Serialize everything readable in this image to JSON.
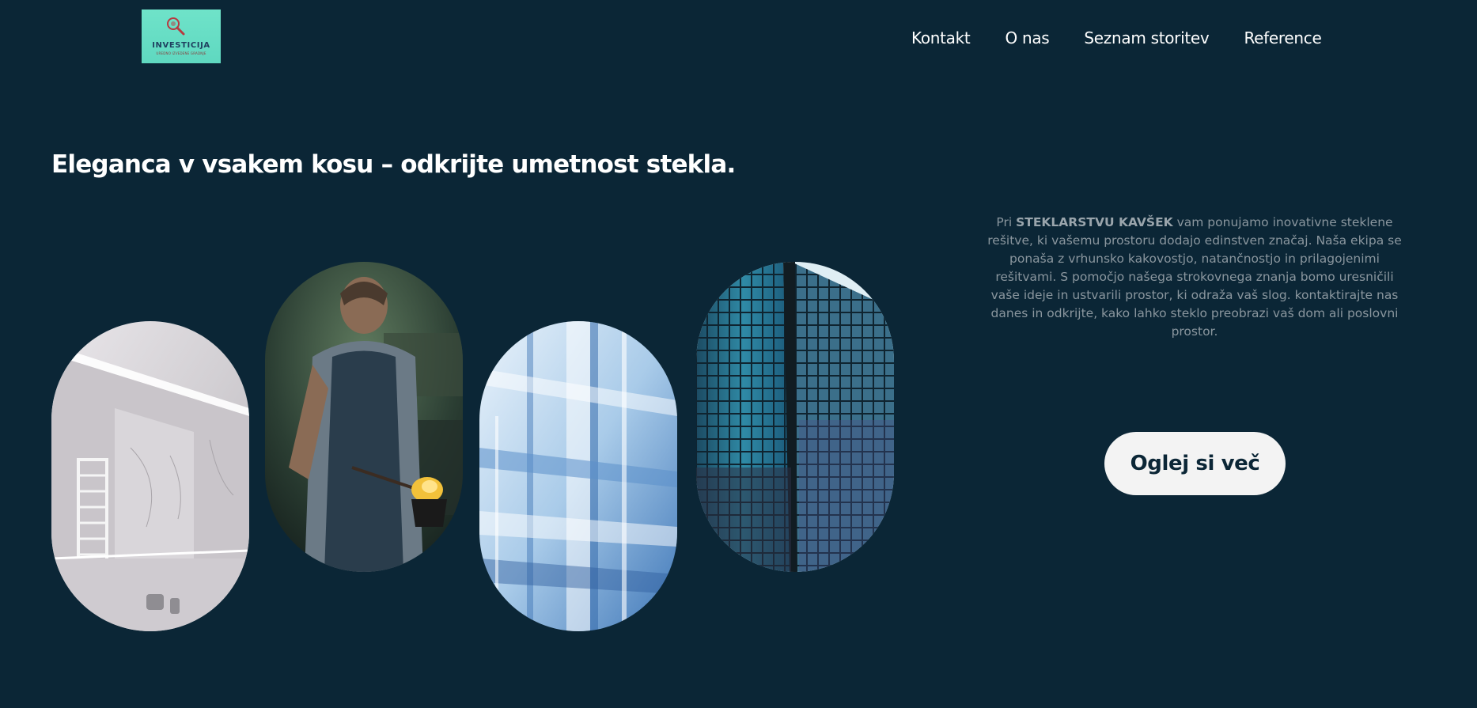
{
  "header": {
    "logo": {
      "title": "INVESTICIJA",
      "subtitle": "UREDNO IZVEDENE GRADNJE",
      "icon": "magnifier-icon",
      "background_color": "#6fe3c9"
    },
    "nav": [
      {
        "label": "Kontakt"
      },
      {
        "label": "O nas"
      },
      {
        "label": "Seznam storitev"
      },
      {
        "label": "Reference"
      }
    ]
  },
  "hero": {
    "headline": "Eleganca v vsakem kosu – odkrijte umetnost stekla.",
    "intro": {
      "prefix": "Pri ",
      "brand": "STEKLARSTVU KAVŠEK",
      "body": " vam ponujamo inovativne steklene rešitve, ki vašemu prostoru dodajo edinstven značaj. Naša ekipa se ponaša z vrhunsko kakovostjo, natančnostjo in prilagojenimi rešitvami. S pomočjo našega strokovnega znanja bomo uresničili vaše ideje in ustvarili prostor, ki odraža vaš slog. kontaktirajte nas danes in odkrijte, kako lahko steklo preobrazi vaš dom ali poslovni prostor."
    },
    "cta_label": "Oglej si več",
    "images": [
      {
        "subject": "bathroom-mirror-image"
      },
      {
        "subject": "glassworker-image"
      },
      {
        "subject": "glass-panels-image"
      },
      {
        "subject": "glass-skyscraper-image"
      }
    ]
  },
  "colors": {
    "background": "#0b2636",
    "text": "#ffffff",
    "muted_text": "#8a969e",
    "button_bg": "#f3f3f3",
    "button_text": "#0b2636"
  }
}
